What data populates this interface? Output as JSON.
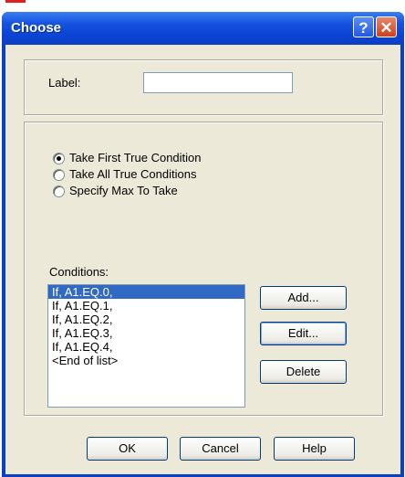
{
  "window": {
    "title": "Choose",
    "help_button": "?",
    "close_button": "✕"
  },
  "label_field": {
    "label": "Label:",
    "value": ""
  },
  "options": [
    {
      "label": "Take First True Condition",
      "checked": true
    },
    {
      "label": "Take All True Conditions",
      "checked": false
    },
    {
      "label": "Specify Max To Take",
      "checked": false
    }
  ],
  "conditions": {
    "label": "Conditions:",
    "items": [
      "If, A1.EQ.0,",
      "If, A1.EQ.1,",
      "If, A1.EQ.2,",
      "If, A1.EQ.3,",
      "If, A1.EQ.4,",
      "<End of list>"
    ],
    "selected_index": 0
  },
  "side_buttons": {
    "add": "Add...",
    "edit": "Edit...",
    "delete": "Delete"
  },
  "footer_buttons": {
    "ok": "OK",
    "cancel": "Cancel",
    "help": "Help"
  }
}
